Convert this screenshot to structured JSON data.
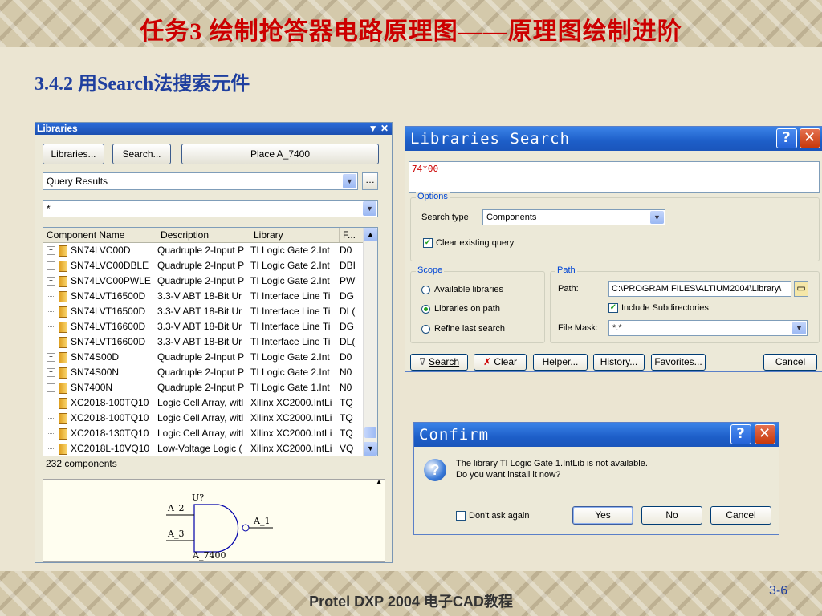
{
  "slide": {
    "title": "任务3  绘制抢答器电路原理图——原理图绘制进阶",
    "subtitle": "3.4.2  用Search法搜索元件",
    "footer": "Protel DXP 2004 电子CAD教程",
    "page_number": "3-6"
  },
  "libraries_panel": {
    "title": "Libraries",
    "title_controls": "▼ ✕",
    "buttons": {
      "libraries": "Libraries...",
      "search": "Search...",
      "place": "Place A_7400"
    },
    "library_combo": "Query Results",
    "filter_combo": "*",
    "columns": [
      "Component Name",
      "Description",
      "Library",
      "F..."
    ],
    "rows": [
      {
        "name": "SN74LVC00D",
        "desc": "Quadruple 2-Input P",
        "lib": "TI Logic Gate 2.Int",
        "fp": "D0",
        "expandable": true
      },
      {
        "name": "SN74LVC00DBLE",
        "desc": "Quadruple 2-Input P",
        "lib": "TI Logic Gate 2.Int",
        "fp": "DBI",
        "expandable": true
      },
      {
        "name": "SN74LVC00PWLE",
        "desc": "Quadruple 2-Input P",
        "lib": "TI Logic Gate 2.Int",
        "fp": "PW",
        "expandable": true
      },
      {
        "name": "SN74LVT16500D",
        "desc": "3.3-V ABT 18-Bit Ur",
        "lib": "TI Interface Line Ti",
        "fp": "DG",
        "expandable": false
      },
      {
        "name": "SN74LVT16500D",
        "desc": "3.3-V ABT 18-Bit Ur",
        "lib": "TI Interface Line Ti",
        "fp": "DL(",
        "expandable": false
      },
      {
        "name": "SN74LVT16600D",
        "desc": "3.3-V ABT 18-Bit Ur",
        "lib": "TI Interface Line Ti",
        "fp": "DG",
        "expandable": false
      },
      {
        "name": "SN74LVT16600D",
        "desc": "3.3-V ABT 18-Bit Ur",
        "lib": "TI Interface Line Ti",
        "fp": "DL(",
        "expandable": false
      },
      {
        "name": "SN74S00D",
        "desc": "Quadruple 2-Input P",
        "lib": "TI Logic Gate 2.Int",
        "fp": "D0",
        "expandable": true
      },
      {
        "name": "SN74S00N",
        "desc": "Quadruple 2-Input P",
        "lib": "TI Logic Gate 2.Int",
        "fp": "N0",
        "expandable": true
      },
      {
        "name": "SN7400N",
        "desc": "Quadruple 2-Input P",
        "lib": "TI Logic Gate 1.Int",
        "fp": "N0",
        "expandable": true
      },
      {
        "name": "XC2018-100TQ10",
        "desc": "Logic Cell Array, witl",
        "lib": "Xilinx XC2000.IntLi",
        "fp": "TQ",
        "expandable": false
      },
      {
        "name": "XC2018-100TQ10",
        "desc": "Logic Cell Array, witl",
        "lib": "Xilinx XC2000.IntLi",
        "fp": "TQ",
        "expandable": false
      },
      {
        "name": "XC2018-130TQ10",
        "desc": "Logic Cell Array, witl",
        "lib": "Xilinx XC2000.IntLi",
        "fp": "TQ",
        "expandable": false
      },
      {
        "name": "XC2018L-10VQ10",
        "desc": "Low-Voltage Logic (",
        "lib": "Xilinx XC2000.IntLi",
        "fp": "VQ",
        "expandable": false
      }
    ],
    "component_count": "232 components",
    "preview": {
      "designator": "U?",
      "pin_in_1": "A_2",
      "pin_in_2": "A_3",
      "pin_out": "A_1",
      "part_name": "A_7400"
    }
  },
  "search_dialog": {
    "title": "Libraries Search",
    "query": "74*00",
    "options_label": "Options",
    "search_type_label": "Search type",
    "search_type_value": "Components",
    "clear_query_label": "Clear existing query",
    "clear_query_checked": true,
    "scope_label": "Scope",
    "scope_options": [
      "Available libraries",
      "Libraries on path",
      "Refine last search"
    ],
    "scope_selected": 1,
    "path_group_label": "Path",
    "path_label": "Path:",
    "path_value": "C:\\PROGRAM FILES\\ALTIUM2004\\Library\\",
    "include_subdirs_label": "Include Subdirectories",
    "include_subdirs_checked": true,
    "file_mask_label": "File Mask:",
    "file_mask_value": "*.*",
    "buttons": {
      "search": "Search",
      "clear": "Clear",
      "helper": "Helper...",
      "history": "History...",
      "favorites": "Favorites...",
      "cancel": "Cancel"
    }
  },
  "confirm_dialog": {
    "title": "Confirm",
    "message_line1": "The library TI Logic Gate 1.IntLib is not available.",
    "message_line2": "Do you want install it now?",
    "dont_ask_label": "Don't ask again",
    "buttons": {
      "yes": "Yes",
      "no": "No",
      "cancel": "Cancel"
    }
  }
}
